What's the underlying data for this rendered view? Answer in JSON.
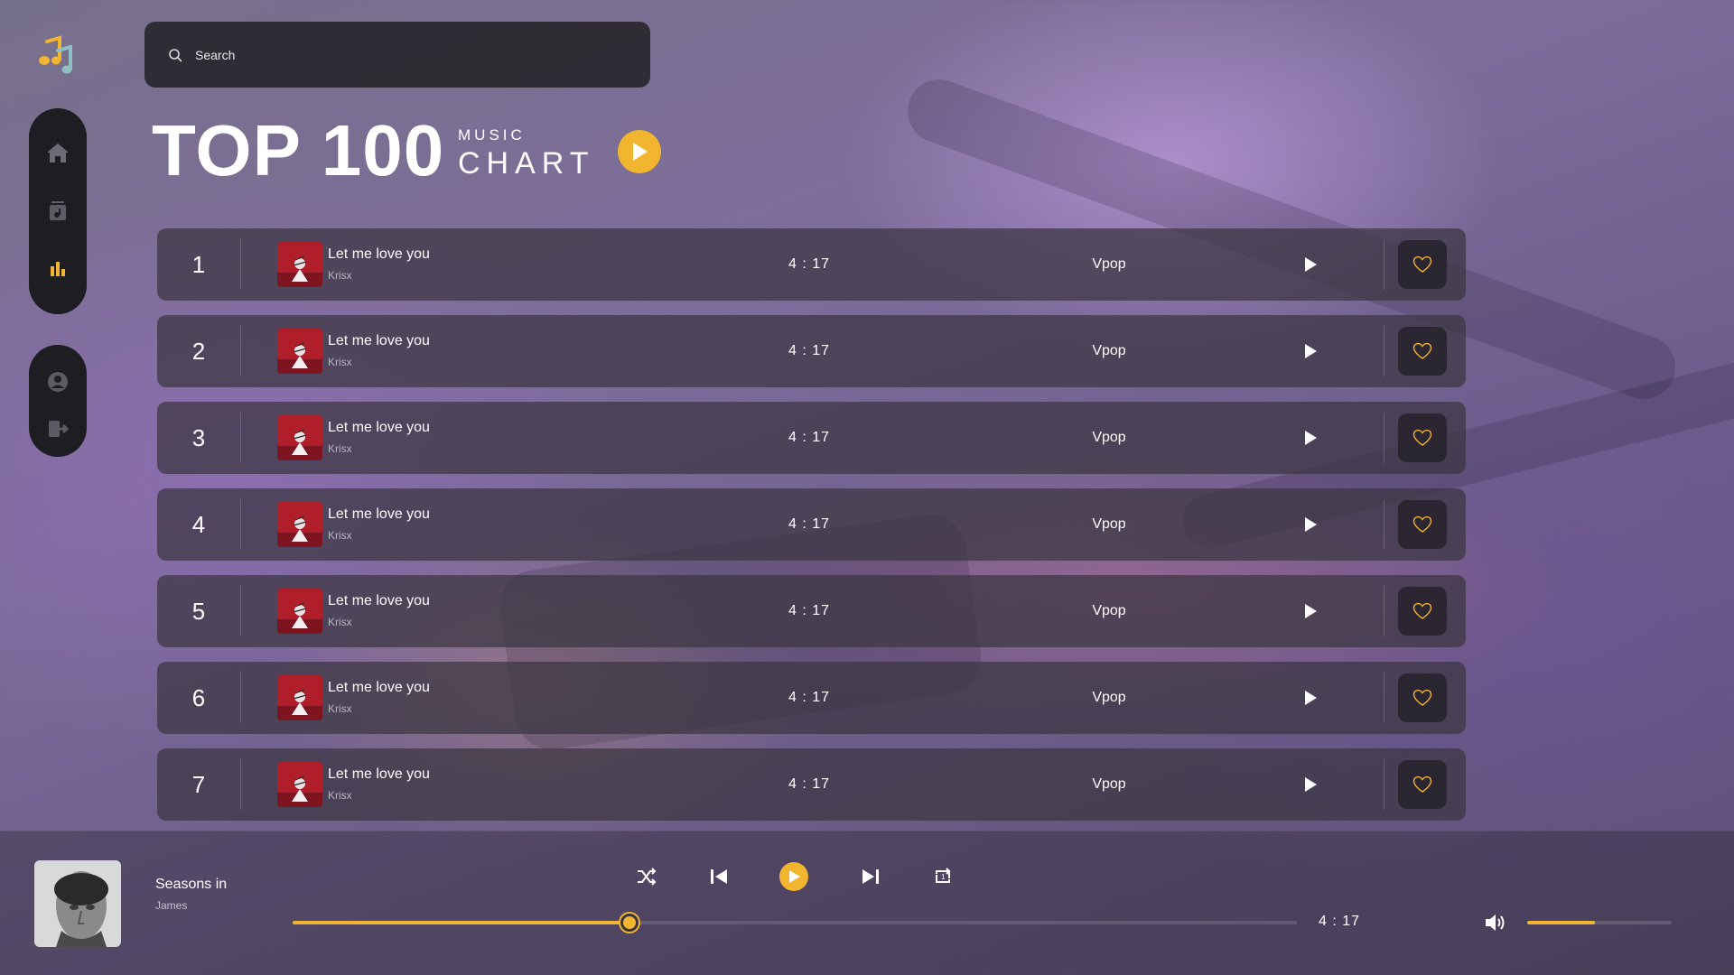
{
  "app": {
    "logo_icon": "music-note-icon",
    "accent_color": "#f1b52f"
  },
  "sidebar": {
    "main_items": [
      {
        "icon": "home-icon",
        "active": false
      },
      {
        "icon": "music-library-icon",
        "active": false
      },
      {
        "icon": "chart-bars-icon",
        "active": true
      }
    ],
    "user_items": [
      {
        "icon": "user-icon"
      },
      {
        "icon": "logout-icon"
      }
    ]
  },
  "search": {
    "placeholder": "Search",
    "value": ""
  },
  "header": {
    "title": "TOP 100",
    "subtitle_small": "MUSIC",
    "subtitle_big": "CHART"
  },
  "tracks": [
    {
      "rank": "1",
      "title": "Let me love you",
      "artist": "Krisx",
      "duration": "4 : 17",
      "genre": "Vpop"
    },
    {
      "rank": "2",
      "title": "Let me love you",
      "artist": "Krisx",
      "duration": "4 : 17",
      "genre": "Vpop"
    },
    {
      "rank": "3",
      "title": "Let me love you",
      "artist": "Krisx",
      "duration": "4 : 17",
      "genre": "Vpop"
    },
    {
      "rank": "4",
      "title": "Let me love you",
      "artist": "Krisx",
      "duration": "4 : 17",
      "genre": "Vpop"
    },
    {
      "rank": "5",
      "title": "Let me love you",
      "artist": "Krisx",
      "duration": "4 : 17",
      "genre": "Vpop"
    },
    {
      "rank": "6",
      "title": "Let me love you",
      "artist": "Krisx",
      "duration": "4 : 17",
      "genre": "Vpop"
    },
    {
      "rank": "7",
      "title": "Let me love you",
      "artist": "Krisx",
      "duration": "4 : 17",
      "genre": "Vpop"
    }
  ],
  "player": {
    "title": "Seasons in",
    "artist": "James",
    "total_time": "4 : 17",
    "progress": 0.335,
    "volume": 0.47,
    "controls": [
      "shuffle-icon",
      "previous-icon",
      "play-icon",
      "next-icon",
      "repeat-one-icon"
    ]
  }
}
